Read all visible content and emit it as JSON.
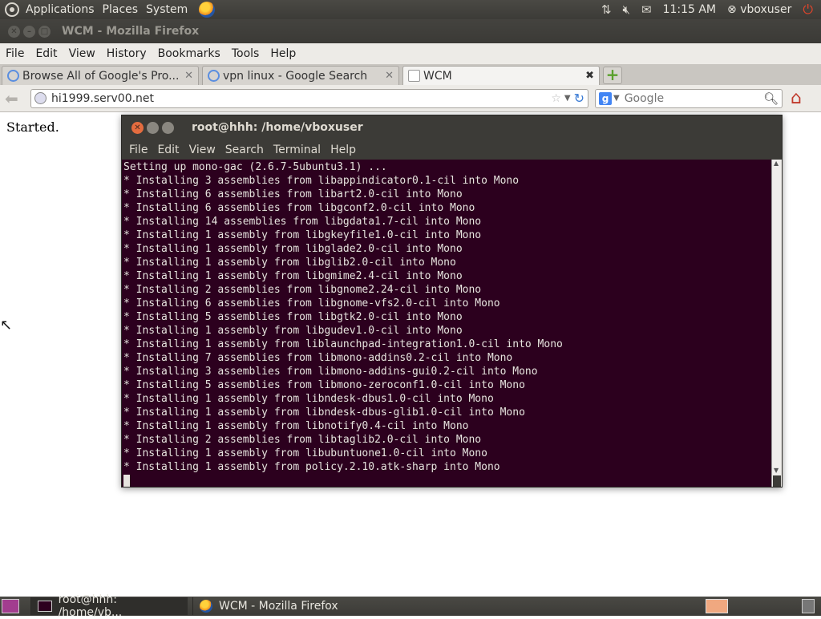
{
  "top_panel": {
    "applications": "Applications",
    "places": "Places",
    "system": "System",
    "clock": "11:15 AM",
    "user": "vboxuser"
  },
  "firefox": {
    "window_title": "WCM - Mozilla Firefox",
    "menu": [
      "File",
      "Edit",
      "View",
      "History",
      "Bookmarks",
      "Tools",
      "Help"
    ],
    "tabs": [
      {
        "label": "Browse All of Google's Pro...",
        "active": false
      },
      {
        "label": "vpn linux - Google Search",
        "active": false
      },
      {
        "label": "WCM",
        "active": true
      }
    ],
    "url": "hi1999.serv00.net",
    "search_placeholder": "Google",
    "page_text": "Started."
  },
  "terminal": {
    "title": "root@hhh: /home/vboxuser",
    "menu": [
      "File",
      "Edit",
      "View",
      "Search",
      "Terminal",
      "Help"
    ],
    "lines": [
      "Setting up mono-gac (2.6.7-5ubuntu3.1) ...",
      "* Installing 3 assemblies from libappindicator0.1-cil into Mono",
      "* Installing 6 assemblies from libart2.0-cil into Mono",
      "* Installing 6 assemblies from libgconf2.0-cil into Mono",
      "* Installing 14 assemblies from libgdata1.7-cil into Mono",
      "* Installing 1 assembly from libgkeyfile1.0-cil into Mono",
      "* Installing 1 assembly from libglade2.0-cil into Mono",
      "* Installing 1 assembly from libglib2.0-cil into Mono",
      "* Installing 1 assembly from libgmime2.4-cil into Mono",
      "* Installing 2 assemblies from libgnome2.24-cil into Mono",
      "* Installing 6 assemblies from libgnome-vfs2.0-cil into Mono",
      "* Installing 5 assemblies from libgtk2.0-cil into Mono",
      "* Installing 1 assembly from libgudev1.0-cil into Mono",
      "* Installing 1 assembly from liblaunchpad-integration1.0-cil into Mono",
      "* Installing 7 assemblies from libmono-addins0.2-cil into Mono",
      "* Installing 3 assemblies from libmono-addins-gui0.2-cil into Mono",
      "* Installing 5 assemblies from libmono-zeroconf1.0-cil into Mono",
      "* Installing 1 assembly from libndesk-dbus1.0-cil into Mono",
      "* Installing 1 assembly from libndesk-dbus-glib1.0-cil into Mono",
      "* Installing 1 assembly from libnotify0.4-cil into Mono",
      "* Installing 2 assemblies from libtaglib2.0-cil into Mono",
      "* Installing 1 assembly from libubuntuone1.0-cil into Mono",
      "* Installing 1 assembly from policy.2.10.atk-sharp into Mono"
    ]
  },
  "taskbar": {
    "items": [
      {
        "label": "root@hhh: /home/vb..."
      },
      {
        "label": "WCM - Mozilla Firefox"
      }
    ]
  }
}
